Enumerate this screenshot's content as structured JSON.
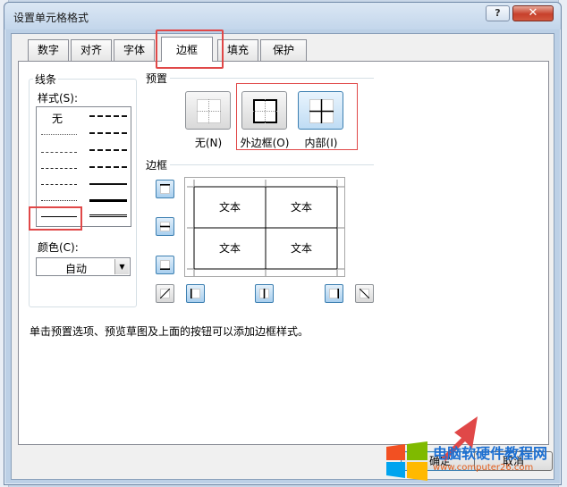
{
  "window": {
    "title": "设置单元格格式"
  },
  "titlebar": {
    "help": "?",
    "close": "✕"
  },
  "tabs": [
    {
      "label": "数字"
    },
    {
      "label": "对齐"
    },
    {
      "label": "字体"
    },
    {
      "label": "边框",
      "active": true
    },
    {
      "label": "填充"
    },
    {
      "label": "保护"
    }
  ],
  "line": {
    "group_label": "线条",
    "style_label": "样式(S):",
    "none_label": "无",
    "color_label": "颜色(C):",
    "color_value": "自动"
  },
  "presets": {
    "title": "预置",
    "items": [
      {
        "label": "无(N)"
      },
      {
        "label": "外边框(O)"
      },
      {
        "label": "内部(I)"
      }
    ]
  },
  "border": {
    "title": "边框",
    "cells": [
      "文本",
      "文本",
      "文本",
      "文本"
    ]
  },
  "info_text": "单击预置选项、预览草图及上面的按钮可以添加边框样式。",
  "buttons": {
    "ok": "确定",
    "cancel": "取消"
  },
  "watermark": {
    "title": "电脑软硬件教程网",
    "url": "www.computer26.com"
  },
  "colors": {
    "highlight": "#e04848",
    "selected_button": "#bfdcf4",
    "accent": "#1c6fd1"
  }
}
